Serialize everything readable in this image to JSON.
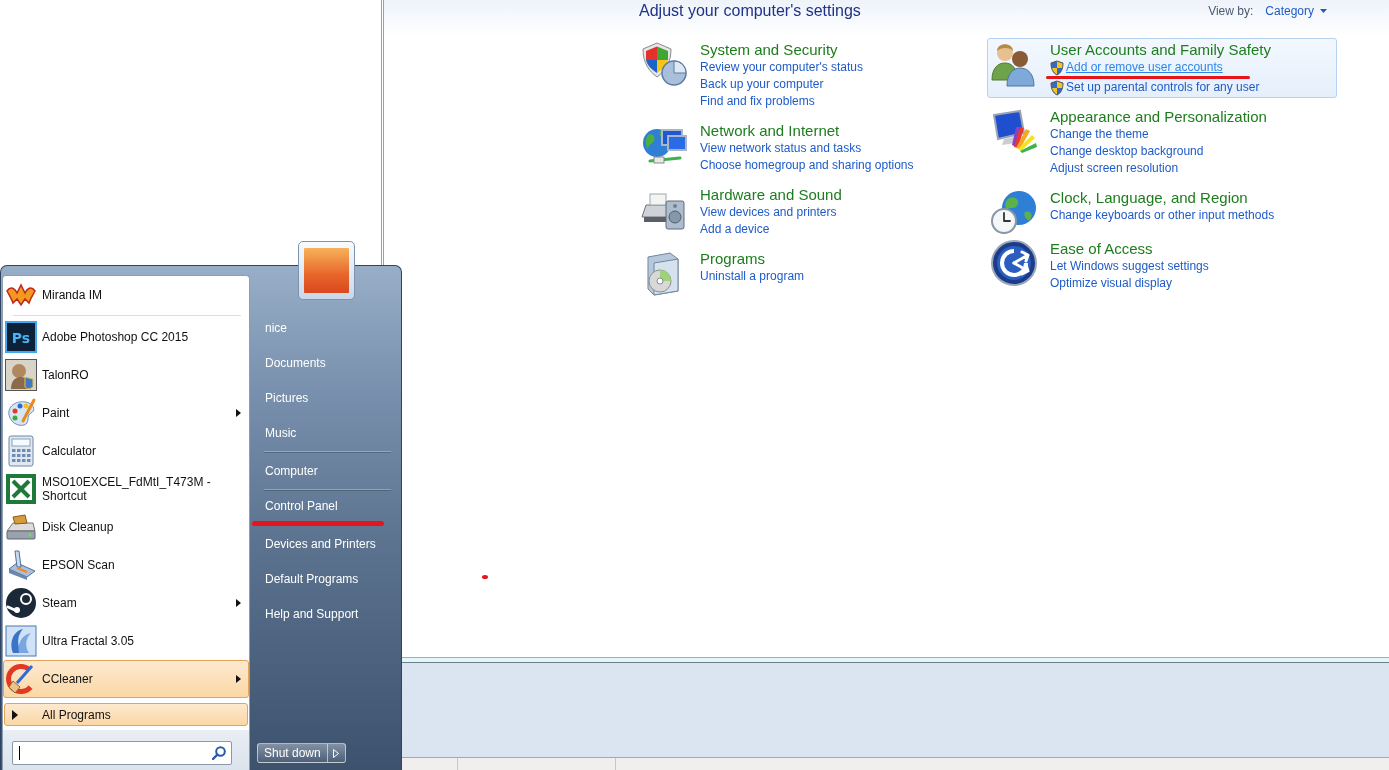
{
  "control_panel": {
    "heading": "Adjust your computer's settings",
    "view_by": {
      "label": "View by:",
      "value": "Category"
    },
    "columns": [
      {
        "categories": [
          {
            "title": "System and Security",
            "highlighted": false,
            "links": [
              {
                "text": "Review your computer's status",
                "admin": false,
                "hovered": false,
                "marked": false
              },
              {
                "text": "Back up your computer",
                "admin": false,
                "hovered": false,
                "marked": false
              },
              {
                "text": "Find and fix problems",
                "admin": false,
                "hovered": false,
                "marked": false
              }
            ]
          },
          {
            "title": "Network and Internet",
            "highlighted": false,
            "links": [
              {
                "text": "View network status and tasks",
                "admin": false,
                "hovered": false,
                "marked": false
              },
              {
                "text": "Choose homegroup and sharing options",
                "admin": false,
                "hovered": false,
                "marked": false
              }
            ]
          },
          {
            "title": "Hardware and Sound",
            "highlighted": false,
            "links": [
              {
                "text": "View devices and printers",
                "admin": false,
                "hovered": false,
                "marked": false
              },
              {
                "text": "Add a device",
                "admin": false,
                "hovered": false,
                "marked": false
              }
            ]
          },
          {
            "title": "Programs",
            "highlighted": false,
            "links": [
              {
                "text": "Uninstall a program",
                "admin": false,
                "hovered": false,
                "marked": false
              }
            ]
          }
        ]
      },
      {
        "categories": [
          {
            "title": "User Accounts and Family Safety",
            "highlighted": true,
            "links": [
              {
                "text": "Add or remove user accounts",
                "admin": true,
                "hovered": true,
                "marked": true
              },
              {
                "text": "Set up parental controls for any user",
                "admin": true,
                "hovered": false,
                "marked": false
              }
            ]
          },
          {
            "title": "Appearance and Personalization",
            "highlighted": false,
            "links": [
              {
                "text": "Change the theme",
                "admin": false,
                "hovered": false,
                "marked": false
              },
              {
                "text": "Change desktop background",
                "admin": false,
                "hovered": false,
                "marked": false
              },
              {
                "text": "Adjust screen resolution",
                "admin": false,
                "hovered": false,
                "marked": false
              }
            ]
          },
          {
            "title": "Clock, Language, and Region",
            "highlighted": false,
            "links": [
              {
                "text": "Change keyboards or other input methods",
                "admin": false,
                "hovered": false,
                "marked": false
              }
            ]
          },
          {
            "title": "Ease of Access",
            "highlighted": false,
            "links": [
              {
                "text": "Let Windows suggest settings",
                "admin": false,
                "hovered": false,
                "marked": false
              },
              {
                "text": "Optimize visual display",
                "admin": false,
                "hovered": false,
                "marked": false
              }
            ]
          }
        ]
      }
    ]
  },
  "start_menu": {
    "pinned": [
      {
        "label": "Miranda IM",
        "submenu": false,
        "selected": false
      }
    ],
    "recent": [
      {
        "label": "Adobe Photoshop CC 2015",
        "icon_text": "Ps",
        "submenu": false,
        "selected": false
      },
      {
        "label": "TalonRO",
        "submenu": false,
        "selected": false
      },
      {
        "label": "Paint",
        "submenu": true,
        "selected": false
      },
      {
        "label": "Calculator",
        "submenu": false,
        "selected": false
      },
      {
        "label": "MSO10EXCEL_FdMtI_T473M - Shortcut",
        "submenu": false,
        "selected": false
      },
      {
        "label": "Disk Cleanup",
        "submenu": false,
        "selected": false
      },
      {
        "label": "EPSON Scan",
        "submenu": false,
        "selected": false
      },
      {
        "label": "Steam",
        "submenu": true,
        "selected": false
      },
      {
        "label": "Ultra Fractal 3.05",
        "submenu": false,
        "selected": false
      },
      {
        "label": "CCleaner",
        "submenu": true,
        "selected": true
      }
    ],
    "all_programs": {
      "label": "All Programs",
      "selected": true
    },
    "place_groups": [
      {
        "items": [
          {
            "label": "nice",
            "selected": false,
            "marked": false
          },
          {
            "label": "Documents",
            "selected": false,
            "marked": false
          },
          {
            "label": "Pictures",
            "selected": false,
            "marked": false
          },
          {
            "label": "Music",
            "selected": false,
            "marked": false
          }
        ]
      },
      {
        "items": [
          {
            "label": "Computer",
            "selected": false,
            "marked": false
          }
        ]
      },
      {
        "items": [
          {
            "label": "Control Panel",
            "selected": false,
            "marked": true
          },
          {
            "label": "Devices and Printers",
            "selected": false,
            "marked": false
          },
          {
            "label": "Default Programs",
            "selected": false,
            "marked": false
          },
          {
            "label": "Help and Support",
            "selected": false,
            "marked": false
          }
        ]
      }
    ],
    "shut_down": {
      "label": "Shut down"
    }
  }
}
